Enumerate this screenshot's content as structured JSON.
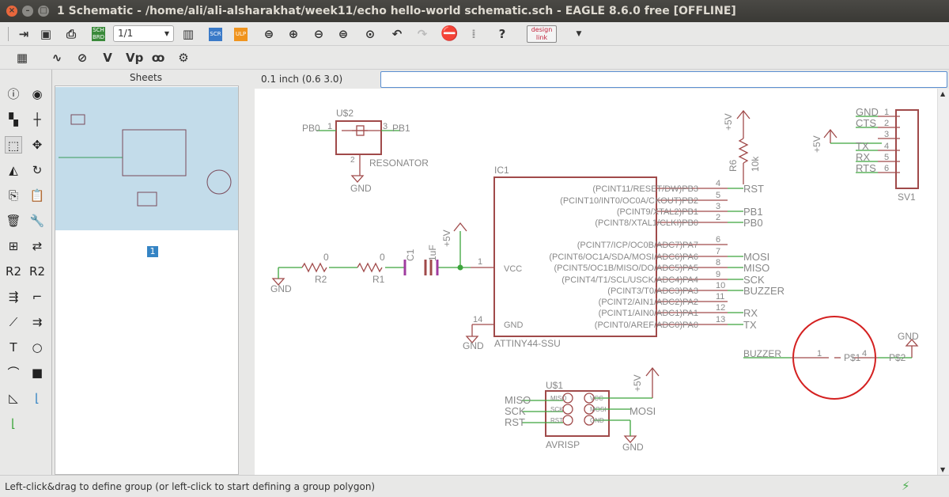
{
  "window": {
    "title": "1 Schematic - /home/ali/ali-alsharakhat/week11/echo hello-world schematic.sch - EAGLE 8.6.0 free [OFFLINE]"
  },
  "toolbar": {
    "page": "1/1",
    "sch_brd": "SCH BRD",
    "scr": "SCR",
    "ulp": "ULP",
    "design_link": "design link",
    "icons": [
      "open",
      "save",
      "print",
      "sch-brd",
      "page-select",
      "layers",
      "script",
      "ulp",
      "zoom-fit",
      "zoom-in",
      "zoom-out",
      "zoom-redraw",
      "zoom-select",
      "undo",
      "redo",
      "stop",
      "go",
      "help",
      "design-link"
    ]
  },
  "toolbar2": {
    "icons": [
      "grid",
      "net",
      "show",
      "value",
      "value-pin",
      "add-net",
      "settings"
    ],
    "v": "V",
    "vp": "Vp"
  },
  "tools": [
    "info",
    "show",
    "display-layers",
    "mark",
    "group",
    "move",
    "mirror",
    "rotate",
    "copy",
    "paste",
    "delete",
    "change",
    "add",
    "replace",
    "name",
    "value",
    "smash",
    "miter",
    "split",
    "optimize",
    "text",
    "circle",
    "arc",
    "rect",
    "polygon",
    "net",
    "bus"
  ],
  "sheets": {
    "title": "Sheets",
    "page_number": "1"
  },
  "coordbar": {
    "coords": "0.1 inch (0.6 3.0)",
    "command": ""
  },
  "status": {
    "text": "Left-click&drag to define group (or left-click to start defining a group polygon)"
  },
  "schematic": {
    "ic1": {
      "name": "IC1",
      "value": "ATTINY44-SSU",
      "vcc": "VCC",
      "gnd": "GND",
      "vcc_pin": "1",
      "gnd_pin": "14",
      "pins": [
        {
          "name": "(PCINT11/RESET/DW)PB3",
          "num": "4",
          "net": "RST"
        },
        {
          "name": "(PCINT10/INT0/OC0A/CKOUT)PB2",
          "num": "5",
          "net": ""
        },
        {
          "name": "(PCINT9/XTAL2)PB1",
          "num": "3",
          "net": "PB1"
        },
        {
          "name": "(PCINT8/XTAL1/CLKI)PB0",
          "num": "2",
          "net": "PB0"
        },
        {
          "name": "(PCINT7/ICP/OC0B/ADC7)PA7",
          "num": "6",
          "net": ""
        },
        {
          "name": "(PCINT6/OC1A/SDA/MOSI/ADC6)PA6",
          "num": "7",
          "net": "MOSI"
        },
        {
          "name": "(PCINT5/OC1B/MISO/DO/ADC5)PA5",
          "num": "8",
          "net": "MISO"
        },
        {
          "name": "(PCINT4/T1/SCL/USCK/ADC4)PA4",
          "num": "9",
          "net": "SCK"
        },
        {
          "name": "(PCINT3/T0/ADC3)PA3",
          "num": "10",
          "net": "BUZZER"
        },
        {
          "name": "(PCINT2/AIN1/ADC2)PA2",
          "num": "11",
          "net": ""
        },
        {
          "name": "(PCINT1/AIN0/ADC1)PA1",
          "num": "12",
          "net": "RX"
        },
        {
          "name": "(PCINT0/AREF/ADC0)PA0",
          "num": "13",
          "net": "TX"
        }
      ]
    },
    "resonator": {
      "name": "U$2",
      "value": "RESONATOR",
      "net1": "PB0",
      "net3": "PB1",
      "pin1": "1",
      "pin2": "2",
      "pin3": "3",
      "gnd": "GND"
    },
    "r1": {
      "name": "R1",
      "value": "0"
    },
    "r2": {
      "name": "R2",
      "value": "0"
    },
    "c1": {
      "name": "C1",
      "value": "1uF"
    },
    "r6": {
      "name": "R6",
      "value": "10k"
    },
    "supply": {
      "p5v": "+5V",
      "gnd": "GND"
    },
    "sv1": {
      "name": "SV1",
      "pins": [
        {
          "num": "1",
          "net": "GND"
        },
        {
          "num": "2",
          "net": "CTS"
        },
        {
          "num": "3",
          "net": ""
        },
        {
          "num": "4",
          "net": "TX"
        },
        {
          "num": "5",
          "net": "RX"
        },
        {
          "num": "6",
          "net": "RTS"
        }
      ]
    },
    "buzzer": {
      "net": "BUZZER",
      "pin1": "1",
      "pin4": "4",
      "p1": "P$1",
      "p2": "P$2"
    },
    "avrisp": {
      "name": "U$1",
      "value": "AVRISP",
      "pads_left": [
        "MISO",
        "SCK",
        "RST"
      ],
      "pads_right": [
        "VCC",
        "MOSI",
        "GND"
      ],
      "nets_left": [
        "MISO",
        "SCK",
        "RST"
      ],
      "net_mosi": "MOSI"
    }
  },
  "colors": {
    "wire": "#3ca53c",
    "part": "#a04a4a",
    "text": "#888888",
    "cap": "#a03ca0",
    "accent": "#3584c4"
  }
}
